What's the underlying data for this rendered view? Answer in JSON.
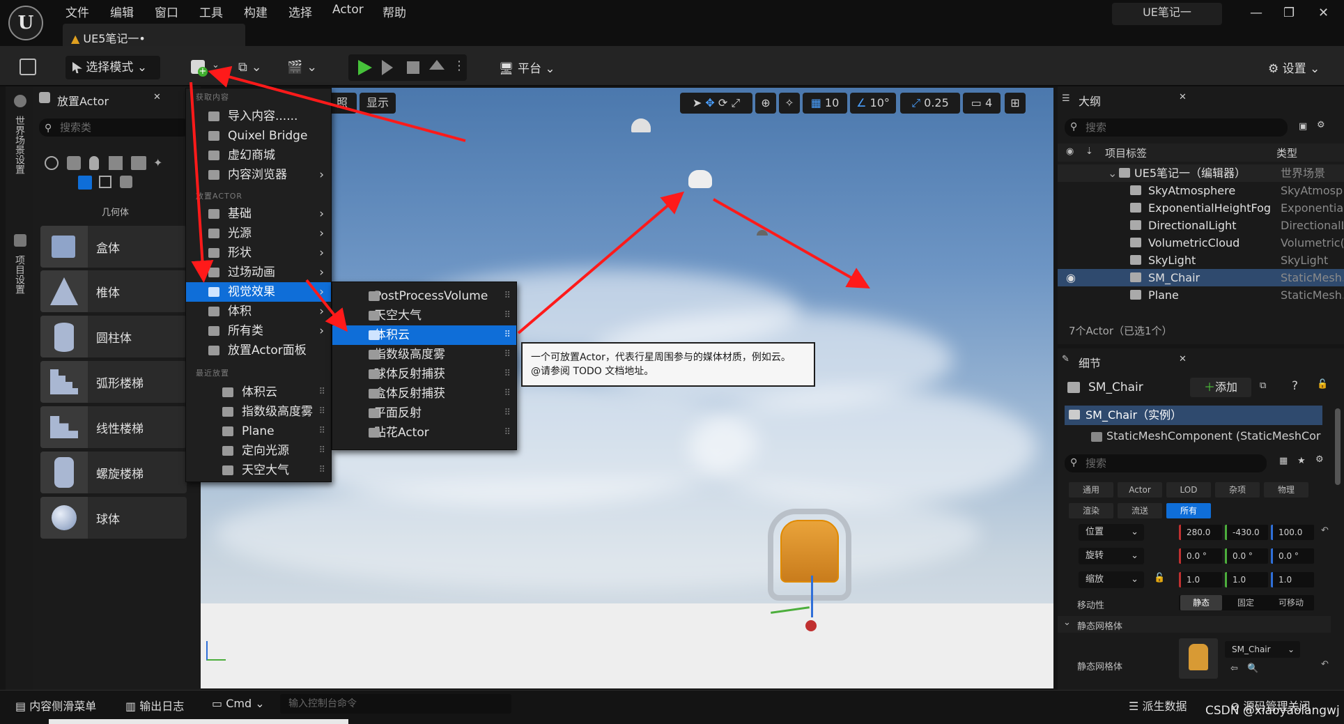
{
  "menubar": {
    "items": [
      "文件",
      "编辑",
      "窗口",
      "工具",
      "构建",
      "选择",
      "Actor",
      "帮助"
    ]
  },
  "document_tab": "UE5笔记一•",
  "project_name": "UE笔记一",
  "toolbar": {
    "select_mode": "选择模式",
    "platform": "平台",
    "settings": "设置"
  },
  "left_strip": {
    "world_settings": "世界场景设置",
    "project_settings": "项目设置"
  },
  "place_actor": {
    "title": "放置Actor",
    "search_placeholder": "搜索类",
    "category_label": "几何体",
    "items": [
      "盒体",
      "椎体",
      "圆柱体",
      "弧形楼梯",
      "线性楼梯",
      "螺旋楼梯",
      "球体"
    ]
  },
  "viewport": {
    "lit_label": "照",
    "show_label": "显示",
    "grid_value": "10",
    "angle_value": "10°",
    "scale_value": "0.25",
    "camera_speed": "4"
  },
  "add_menu": {
    "section_get": "获取内容",
    "get_items": [
      "导入内容......",
      "Quixel Bridge",
      "虚幻商城",
      "内容浏览器"
    ],
    "section_place": "放置ACTOR",
    "place_items": [
      "基础",
      "光源",
      "形状",
      "过场动画",
      "视觉效果",
      "体积",
      "所有类",
      "放置Actor面板"
    ],
    "section_recent": "最近放置",
    "recent_items": [
      "体积云",
      "指数级高度雾",
      "Plane",
      "定向光源",
      "天空大气"
    ]
  },
  "visual_effects_menu": {
    "items": [
      "PostProcessVolume",
      "天空大气",
      "体积云",
      "指数级高度雾",
      "球体反射捕获",
      "盒体反射捕获",
      "平面反射",
      "贴花Actor"
    ]
  },
  "tooltip": {
    "line1": "一个可放置Actor，代表行星周围参与的媒体材质，例如云。",
    "line2": "@请参阅 TODO 文档地址。"
  },
  "outliner": {
    "title": "大纲",
    "search_placeholder": "搜索",
    "col_label": "项目标签",
    "col_type": "类型",
    "root_name": "UE5笔记一（编辑器）",
    "root_type": "世界场景",
    "rows": [
      {
        "name": "SkyAtmosphere",
        "type": "SkyAtmosp"
      },
      {
        "name": "ExponentialHeightFog",
        "type": "Exponential"
      },
      {
        "name": "DirectionalLight",
        "type": "DirectionalL"
      },
      {
        "name": "VolumetricCloud",
        "type": "Volumetric("
      },
      {
        "name": "SkyLight",
        "type": "SkyLight"
      },
      {
        "name": "SM_Chair",
        "type": "StaticMesh."
      },
      {
        "name": "Plane",
        "type": "StaticMesh."
      }
    ],
    "status": "7个Actor（已选1个）"
  },
  "details": {
    "title": "细节",
    "actor_name": "SM_Chair",
    "add_label": "添加",
    "instance_label": "SM_Chair（实例）",
    "component_label": "StaticMeshComponent (StaticMeshCor",
    "search_placeholder": "搜索",
    "tabs_row1": [
      "通用",
      "Actor",
      "LOD",
      "杂项",
      "物理"
    ],
    "tabs_row2": [
      "渲染",
      "流送",
      "所有"
    ],
    "location_label": "位置",
    "location": [
      "280.0",
      "-430.0",
      "100.0"
    ],
    "rotation_label": "旋转",
    "rotation": [
      "0.0 °",
      "0.0 °",
      "0.0 °"
    ],
    "scale_label": "缩放",
    "scale": [
      "1.0",
      "1.0",
      "1.0"
    ],
    "mobility_label": "移动性",
    "mobility_options": [
      "静态",
      "固定",
      "可移动"
    ],
    "section_static_mesh": "静态网格体",
    "static_mesh_label": "静态网格体",
    "static_mesh_value": "SM_Chair"
  },
  "bottombar": {
    "content_drawer": "内容侧滑菜单",
    "output_log": "输出日志",
    "cmd": "Cmd",
    "console_placeholder": "输入控制台命令",
    "derived_data": "派生数据",
    "source_control": "源码管理关闭",
    "watermark": "CSDN @xiaoyaolangwj"
  }
}
